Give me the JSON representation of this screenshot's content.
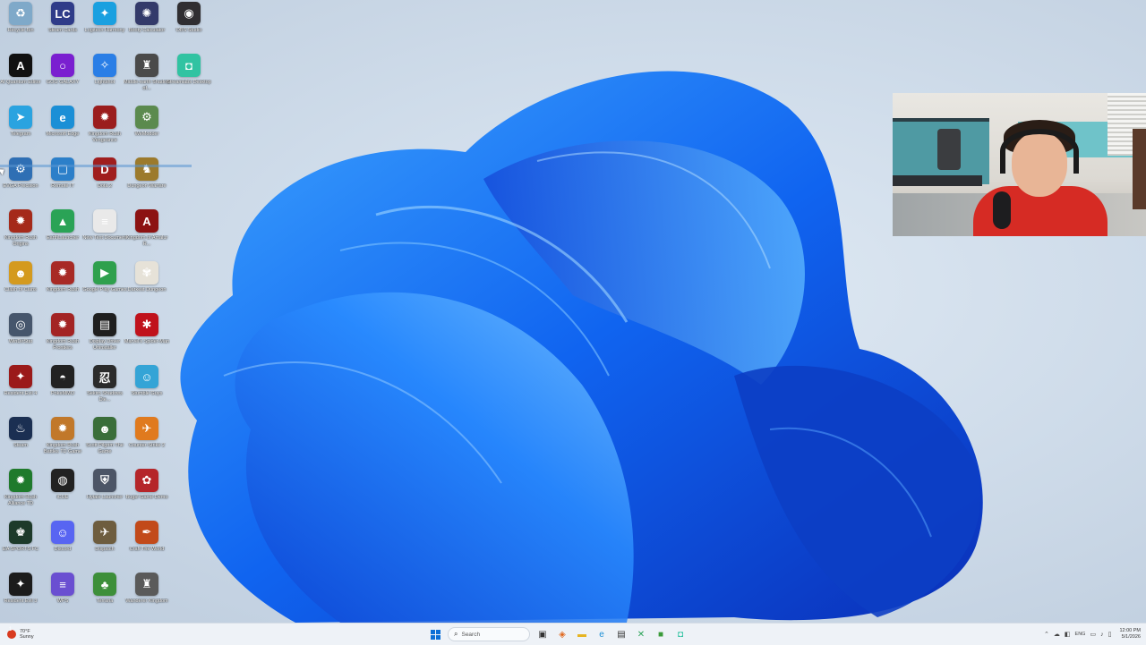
{
  "desktop_icons": [
    {
      "label": "Recycle Bin",
      "icon": "recycle-bin-icon",
      "color": "#7fa9c9",
      "glyph": "♻"
    },
    {
      "label": "Steam Cards",
      "icon": "steam-cards-icon",
      "color": "#2f3c89",
      "glyph": "LC"
    },
    {
      "label": "Logitech Harmony",
      "icon": "logitech-icon",
      "color": "#1aa0e0",
      "glyph": "✦"
    },
    {
      "label": "Booty Calculator",
      "icon": "booty-calculator-icon",
      "color": "#333a6a",
      "glyph": "✺"
    },
    {
      "label": "OBS Studio",
      "icon": "obs-icon",
      "color": "#302e31",
      "glyph": "◉"
    },
    {
      "label": "AI Quantum Editor",
      "icon": "ai-editor-icon",
      "color": "#111111",
      "glyph": "A"
    },
    {
      "label": "GOG GALAXY",
      "icon": "gog-galaxy-icon",
      "color": "#7a1fd0",
      "glyph": "○"
    },
    {
      "label": "Lightshot",
      "icon": "lightshot-icon",
      "color": "#2a7ee6",
      "glyph": "✧"
    },
    {
      "label": "Middle-earth Shadow of...",
      "icon": "middle-earth-icon",
      "color": "#4a4a4a",
      "glyph": "♜"
    },
    {
      "label": "Streamlabs Desktop",
      "icon": "streamlabs-icon",
      "color": "#31c3a2",
      "glyph": "◘"
    },
    {
      "label": "Telegram",
      "icon": "telegram-icon",
      "color": "#2aa3e0",
      "glyph": "➤"
    },
    {
      "label": "Microsoft Edge",
      "icon": "edge-icon",
      "color": "#1b8fd6",
      "glyph": "e"
    },
    {
      "label": "Kingdom Rush Vengeance",
      "icon": "kingdom-rush-vengeance-icon",
      "color": "#9b1d1d",
      "glyph": "✹"
    },
    {
      "label": "WeModder",
      "icon": "wemod-icon",
      "color": "#5b8a4e",
      "glyph": "⚙"
    },
    {
      "label": "EVGA Precision",
      "icon": "evga-icon",
      "color": "#2f6fb4",
      "glyph": "⚙"
    },
    {
      "label": "Remote IT",
      "icon": "remote-it-icon",
      "color": "#2c7fc9",
      "glyph": "▢"
    },
    {
      "label": "Dota 2",
      "icon": "dota2-icon",
      "color": "#a01e1e",
      "glyph": "D"
    },
    {
      "label": "Dungeon Warfare",
      "icon": "dungeon-warfare-icon",
      "color": "#9c7a2c",
      "glyph": "♞"
    },
    {
      "label": "Kingdom Rush Origins",
      "icon": "kingdom-rush-origins-icon",
      "color": "#a52a1a",
      "glyph": "✹"
    },
    {
      "label": "EarthLauncher",
      "icon": "earth-launcher-icon",
      "color": "#2aa356",
      "glyph": "▲"
    },
    {
      "label": "New Text Document",
      "icon": "text-document-icon",
      "color": "#e9e9e9",
      "glyph": "≡"
    },
    {
      "label": "Kingdom of Amalur R...",
      "icon": "amalur-icon",
      "color": "#8c1212",
      "glyph": "A"
    },
    {
      "label": "Clash of Clans",
      "icon": "clash-of-clans-icon",
      "color": "#d49a1e",
      "glyph": "☻"
    },
    {
      "label": "Kingdom Rush",
      "icon": "kingdom-rush-icon",
      "color": "#a82a25",
      "glyph": "✹"
    },
    {
      "label": "Google Play Games",
      "icon": "google-play-icon",
      "color": "#2fa04d",
      "glyph": "▶"
    },
    {
      "label": "Darkest Dungeon",
      "icon": "darkest-dungeon-icon",
      "color": "#e6e2d8",
      "glyph": "✾"
    },
    {
      "label": "WinDirStat",
      "icon": "windirstat-icon",
      "color": "#46566c",
      "glyph": "◎"
    },
    {
      "label": "Kingdom Rush Frontiers",
      "icon": "kingdom-rush-frontiers-icon",
      "color": "#a32424",
      "glyph": "✹"
    },
    {
      "label": "Display Driver Uninstaller",
      "icon": "ddu-icon",
      "color": "#1f1f1f",
      "glyph": "▤"
    },
    {
      "label": "Marvel's Spider-Man",
      "icon": "spider-man-icon",
      "color": "#c0121c",
      "glyph": "✱"
    },
    {
      "label": "Resident Evil 4",
      "icon": "resident-evil-icon",
      "color": "#9b1a1a",
      "glyph": "✦"
    },
    {
      "label": "PokeMMO",
      "icon": "pokemmo-icon",
      "color": "#222222",
      "glyph": "◓"
    },
    {
      "label": "Sekiro Shadows Die...",
      "icon": "sekiro-icon",
      "color": "#2b2b2b",
      "glyph": "忍"
    },
    {
      "label": "Stumble Guys",
      "icon": "stumble-guys-icon",
      "color": "#34a4d6",
      "glyph": "☺"
    },
    {
      "label": "Steam",
      "icon": "steam-icon",
      "color": "#1b2f52",
      "glyph": "♨"
    },
    {
      "label": "Kingdom Rush Battles TD Game",
      "icon": "kingdom-rush-battles-icon",
      "color": "#c1782a",
      "glyph": "✹"
    },
    {
      "label": "Scott Pilgrim The Game",
      "icon": "scott-pilgrim-icon",
      "color": "#3a6e3a",
      "glyph": "☻"
    },
    {
      "label": "Counter-Strike 2",
      "icon": "counter-strike-icon",
      "color": "#e07a1e",
      "glyph": "✈"
    },
    {
      "label": "Kingdom Rush Alliance TD",
      "icon": "kingdom-rush-alliance-icon",
      "color": "#1f7a2c",
      "glyph": "✹"
    },
    {
      "label": "iCUE",
      "icon": "icue-icon",
      "color": "#222222",
      "glyph": "◍"
    },
    {
      "label": "Hytale Launcher",
      "icon": "hytale-icon",
      "color": "#4c5566",
      "glyph": "⛨"
    },
    {
      "label": "Bugs! Game Demo",
      "icon": "bugs-game-icon",
      "color": "#b5262a",
      "glyph": "✿"
    },
    {
      "label": "EA SPORTS FC",
      "icon": "ea-fc-icon",
      "color": "#1d3a2a",
      "glyph": "♚"
    },
    {
      "label": "Discord",
      "icon": "discord-icon",
      "color": "#5865f2",
      "glyph": "☺"
    },
    {
      "label": "Dispatch",
      "icon": "dispatch-icon",
      "color": "#6e5d3f",
      "glyph": "✈"
    },
    {
      "label": "Craft The World",
      "icon": "craft-the-world-icon",
      "color": "#c24a1a",
      "glyph": "✒"
    },
    {
      "label": "Resident Evil 3",
      "icon": "resident-evil-3-icon",
      "color": "#1c1c1c",
      "glyph": "✦"
    },
    {
      "label": "WPS",
      "icon": "wps-icon",
      "color": "#6a4fd1",
      "glyph": "≡"
    },
    {
      "label": "Terraria",
      "icon": "terraria-icon",
      "color": "#3d8f3a",
      "glyph": "♣"
    },
    {
      "label": "Wanderer Kingdom",
      "icon": "wanderer-kingdom-icon",
      "color": "#5a5a5a",
      "glyph": "♜"
    }
  ],
  "taskbar": {
    "weather": {
      "temp": "70°F",
      "condition": "Sunny"
    },
    "search_placeholder": "Search",
    "pinned": [
      {
        "name": "task-view-icon",
        "glyph": "▣",
        "color": "#333"
      },
      {
        "name": "widgets-icon",
        "glyph": "◈",
        "color": "#e0681e"
      },
      {
        "name": "file-explorer-icon",
        "glyph": "▬",
        "color": "#e6b422"
      },
      {
        "name": "edge-taskbar-icon",
        "glyph": "e",
        "color": "#1b8fd6"
      },
      {
        "name": "terminal-icon",
        "glyph": "▤",
        "color": "#333"
      },
      {
        "name": "xbox-icon",
        "glyph": "✕",
        "color": "#2aa356"
      },
      {
        "name": "minecraft-icon",
        "glyph": "■",
        "color": "#3a9b3a"
      },
      {
        "name": "streamlabs-taskbar-icon",
        "glyph": "◘",
        "color": "#31c3a2"
      }
    ],
    "tray": {
      "lang": "ENG",
      "time": "12:00 PM",
      "date": "5/1/2026"
    }
  }
}
